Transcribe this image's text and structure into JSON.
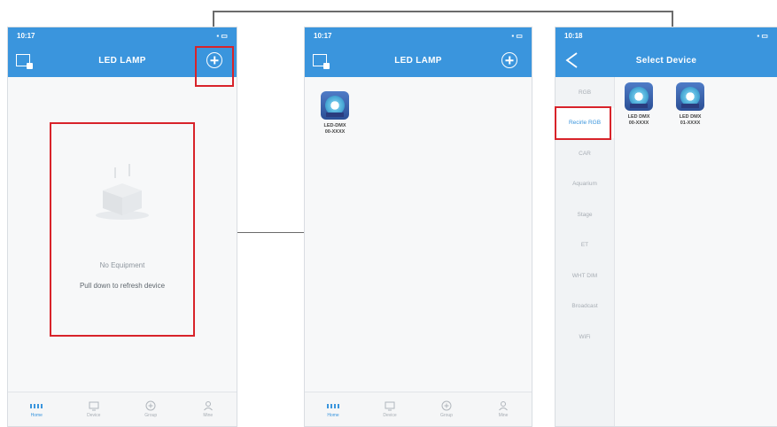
{
  "screens": {
    "left": {
      "status_time": "10:17",
      "title": "LED LAMP",
      "empty_title": "No Equipment",
      "empty_hint": "Pull down to refresh device"
    },
    "middle": {
      "status_time": "10:17",
      "title": "LED LAMP",
      "device_label_1": "LED-DMX",
      "device_label_2": "00-XXXX"
    },
    "right": {
      "status_time": "10:18",
      "title": "Select Device",
      "categories": [
        "RGB",
        "Recirle RGB",
        "CAR",
        "Aquarium",
        "Stage",
        "ET",
        "WHT DIM",
        "Broadcast",
        "WiFi"
      ],
      "devices": [
        {
          "line1": "LED DMX",
          "line2": "00-XXXX"
        },
        {
          "line1": "LED DMX",
          "line2": "01-XXXX"
        }
      ]
    }
  },
  "tabbar": {
    "items": [
      {
        "label": "Home",
        "icon": "home-grid-icon"
      },
      {
        "label": "Device",
        "icon": "device-icon"
      },
      {
        "label": "Group",
        "icon": "group-icon"
      },
      {
        "label": "Mine",
        "icon": "user-icon"
      }
    ]
  },
  "colors": {
    "header": "#3a95dd",
    "highlight_box": "#d8232a",
    "connector": "#6b6b6b"
  }
}
